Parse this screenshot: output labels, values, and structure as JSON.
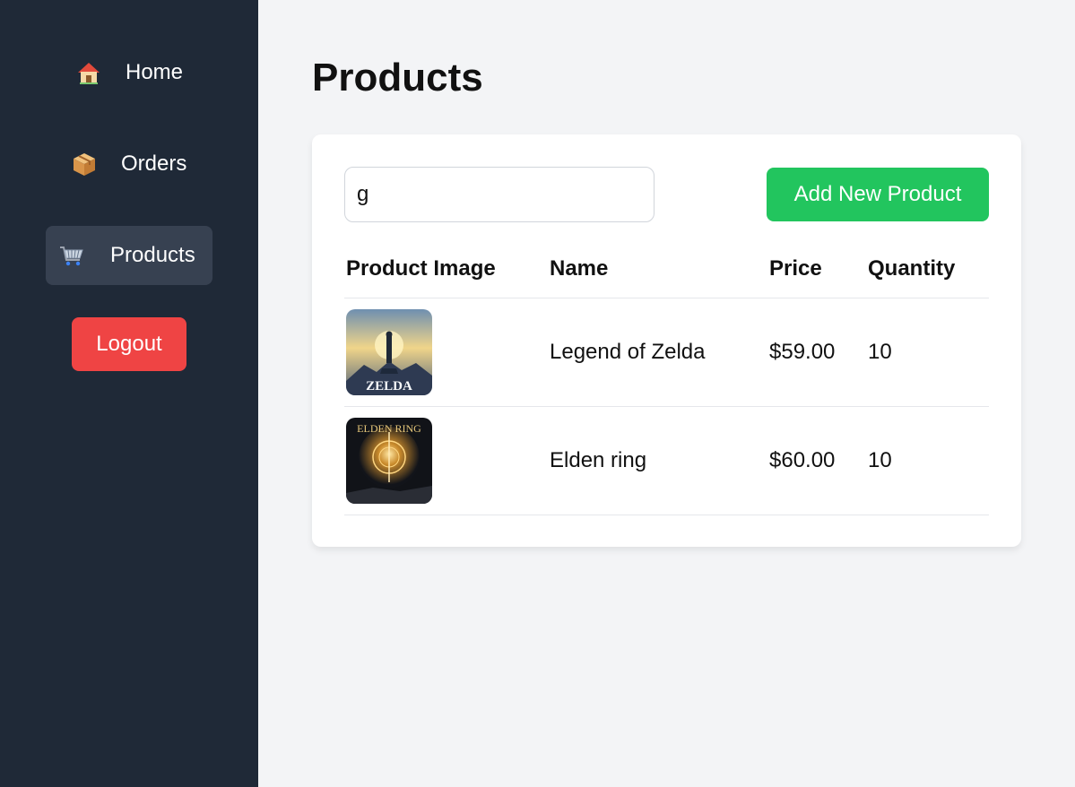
{
  "sidebar": {
    "items": [
      {
        "label": "Home",
        "icon": "house-icon"
      },
      {
        "label": "Orders",
        "icon": "package-icon"
      },
      {
        "label": "Products",
        "icon": "cart-icon",
        "active": true
      }
    ],
    "logout_label": "Logout"
  },
  "page": {
    "title": "Products"
  },
  "search": {
    "value": "g"
  },
  "toolbar": {
    "add_label": "Add New Product"
  },
  "table": {
    "headers": {
      "image": "Product Image",
      "name": "Name",
      "price": "Price",
      "quantity": "Quantity"
    },
    "rows": [
      {
        "name": "Legend of Zelda",
        "price": "$59.00",
        "quantity": "10",
        "image_text": "ZELDA"
      },
      {
        "name": "Elden ring",
        "price": "$60.00",
        "quantity": "10",
        "image_text": "ELDEN RING"
      }
    ]
  },
  "colors": {
    "sidebar_bg": "#1f2937",
    "active_item_bg": "#374151",
    "logout": "#ef4444",
    "add_button": "#22c55e",
    "page_bg": "#f3f4f6"
  }
}
